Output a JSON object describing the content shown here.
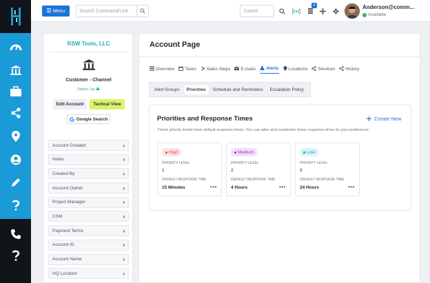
{
  "topbar": {
    "menu_label": "Menu",
    "command_search_placeholder": "Search Command/Link",
    "case_placeholder": "Case#",
    "notification_count": "6",
    "user_name": "Anderson@comm...",
    "user_status": "Available"
  },
  "account": {
    "name": "RSW Tools, LLC",
    "type": "Customer - Channel",
    "status": "Status: Up",
    "edit_label": "Edit Account",
    "tactical_label": "Tactical View",
    "google_label": "Google Search",
    "fields": [
      "Account Created",
      "Notes",
      "Created By",
      "Account Owner",
      "Project Manager",
      "CSM",
      "Payment Terms",
      "Account ID",
      "Account Name",
      "HQ Location"
    ]
  },
  "main": {
    "title": "Account Page",
    "tabs": [
      {
        "label": "Overview",
        "icon": "list-icon",
        "active": false
      },
      {
        "label": "Tasks",
        "icon": "calendar-icon",
        "active": false
      },
      {
        "label": "Sales Steps",
        "icon": "arrow-icon",
        "active": false
      },
      {
        "label": "E-mails",
        "icon": "mail-icon",
        "active": false
      },
      {
        "label": "Alerts",
        "icon": "alert-icon",
        "active": true
      },
      {
        "label": "Locations",
        "icon": "pin-icon",
        "active": false
      },
      {
        "label": "Services",
        "icon": "share-icon",
        "active": false
      },
      {
        "label": "History",
        "icon": "share-icon",
        "active": false
      }
    ],
    "subtabs": [
      {
        "label": "Alert Groups",
        "active": false
      },
      {
        "label": "Priorities",
        "active": true
      },
      {
        "label": "Schedule and Reminders",
        "active": false
      },
      {
        "label": "Escalation Policy",
        "active": false
      }
    ]
  },
  "priorities": {
    "title": "Priorities and Response Times",
    "create_label": "Create New",
    "description": "These priority levels have default response times. You can alter and customize these response times to your preference.",
    "level_label": "PRIORITY LEVEL",
    "response_label": "DEFAULT RESPONSE TIME",
    "cards": [
      {
        "name": "High",
        "level": "1",
        "response": "15 Minutes",
        "color": "#e0454f",
        "bg": "#fde2e4"
      },
      {
        "name": "Medium",
        "level": "2",
        "response": "4 Hours",
        "color": "#9b2fd1",
        "bg": "#f2defb"
      },
      {
        "name": "Low",
        "level": "3",
        "response": "24 Hours",
        "color": "#1aa6b7",
        "bg": "#d8f5f8"
      }
    ]
  },
  "colors": {
    "rail": "#1b9ad8",
    "rail_dark": "#111418",
    "accent": "#1b74d9",
    "tactical": "#d9f46b",
    "available": "#2eb872"
  }
}
